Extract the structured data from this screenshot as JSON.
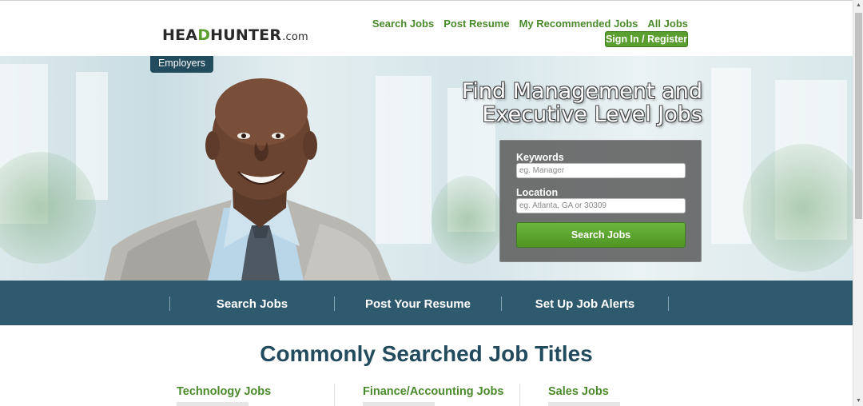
{
  "header": {
    "logo_main_prefix": "HEA",
    "logo_main_d": "D",
    "logo_main_suffix": "HUNTER",
    "logo_dotcom": ".com",
    "nav": [
      "Search Jobs",
      "Post Resume",
      "My Recommended Jobs",
      "All Jobs"
    ],
    "signin_label": "Sign In / Register"
  },
  "employers_tab": "Employers",
  "hero": {
    "title_line1": "Find Management and",
    "title_line2": "Executive Level Jobs"
  },
  "search": {
    "keywords_label": "Keywords",
    "keywords_placeholder": "eg. Manager",
    "location_label": "Location",
    "location_placeholder": "eg. Atlanta, GA or 30309",
    "button_label": "Search Jobs"
  },
  "actions": [
    "Search Jobs",
    "Post Your Resume",
    "Set Up Job Alerts"
  ],
  "main": {
    "section_title": "Commonly Searched Job Titles",
    "categories": [
      "Technology Jobs",
      "Finance/Accounting Jobs",
      "Sales Jobs"
    ]
  },
  "colors": {
    "brand_green": "#5a9e2f",
    "brand_navy": "#234b5e",
    "action_bar": "#2f5a6e"
  }
}
